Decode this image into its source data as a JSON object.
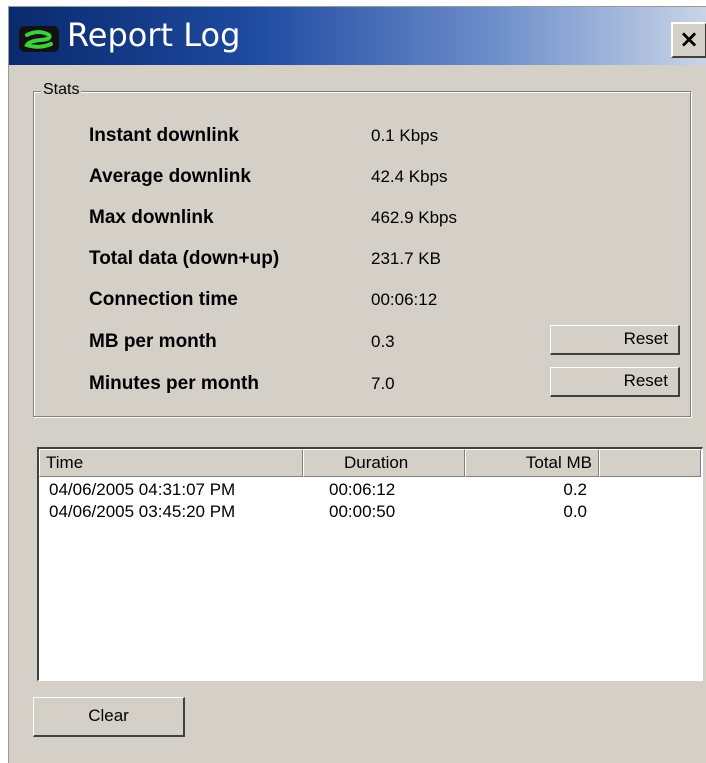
{
  "window": {
    "title": "Report Log",
    "close_label": "×"
  },
  "stats": {
    "legend": "Stats",
    "rows": [
      {
        "label": "Instant downlink",
        "value": "0.1 Kbps"
      },
      {
        "label": "Average downlink",
        "value": "42.4 Kbps"
      },
      {
        "label": "Max downlink",
        "value": "462.9 Kbps"
      },
      {
        "label": "Total data (down+up)",
        "value": "231.7 KB"
      },
      {
        "label": "Connection time",
        "value": "00:06:12"
      },
      {
        "label": "MB per month",
        "value": "0.3",
        "button": "Reset"
      },
      {
        "label": "Minutes per month",
        "value": "7.0",
        "button": "Reset"
      }
    ]
  },
  "log": {
    "columns": [
      "Time",
      "Duration",
      "Total MB"
    ],
    "rows": [
      [
        "04/06/2005 04:31:07 PM",
        "00:06:12",
        "0.2"
      ],
      [
        "04/06/2005 03:45:20 PM",
        "00:00:50",
        "0.0"
      ]
    ]
  },
  "clear_button": "Clear",
  "colors": {
    "titlebar_start": "#0a2a6e",
    "titlebar_end": "#c9d4e6",
    "face": "#d4d0c8",
    "icon_green": "#3ad13a"
  },
  "icons": {
    "app": "app-logo-icon",
    "close": "close-icon"
  }
}
